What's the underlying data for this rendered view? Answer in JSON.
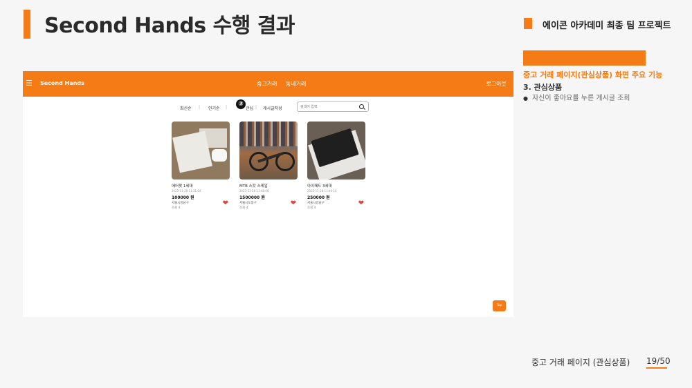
{
  "slide": {
    "title": "Second Hands 수행 결과",
    "org_label": "에이콘 아카데미 최종 팀 프로젝트",
    "side_heading": "중고 거래 페이지(관심상품) 화면 주요 기능",
    "side_sub": "3. 관심상품",
    "side_bullet": "자신이 좋아요를 누른 게시글 조회",
    "footer_text": "중고 거래 페이지 (관심상품)",
    "page_num": "19/50"
  },
  "app": {
    "brand": "Second Hands",
    "nav_links": [
      "중고거래",
      "동네거래"
    ],
    "login": "로그아웃",
    "sort_options": [
      "최신순",
      "인기순",
      "관심",
      "게시글작성"
    ],
    "marker": "③",
    "search_placeholder": "검색어 입력",
    "top_button": "Top",
    "products": [
      {
        "name": "에어팟 1세대",
        "date": "2023-11-28 11:31:04",
        "price": "100000 원",
        "location": "서울시강남구",
        "views": "조회 4"
      },
      {
        "name": "MTB 스캇 스케일",
        "date": "2023-11-28 11:46:08",
        "price": "1500000 원",
        "location": "서울시도봉구",
        "views": "조회 4"
      },
      {
        "name": "아이패드 3세대",
        "date": "2023-11-28 11:46:16",
        "price": "250000 원",
        "location": "서울시강남구",
        "views": "조회 4"
      }
    ]
  },
  "colors": {
    "accent": "#f47b16",
    "heart": "#e2443d"
  }
}
